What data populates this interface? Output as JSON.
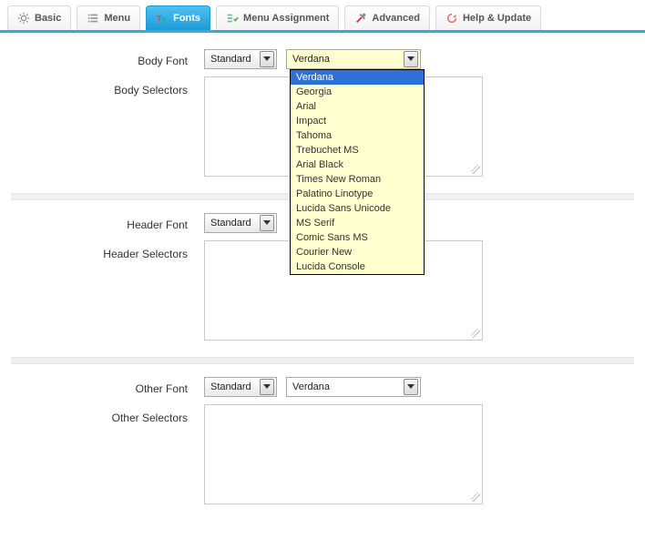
{
  "tabs": {
    "basic": "Basic",
    "menu": "Menu",
    "fonts": "Fonts",
    "menu_assignment": "Menu Assignment",
    "advanced": "Advanced",
    "help_update": "Help & Update"
  },
  "sections": {
    "body": {
      "font_label": "Body Font",
      "selectors_label": "Body Selectors",
      "type_value": "Standard",
      "font_value": "Verdana"
    },
    "header": {
      "font_label": "Header Font",
      "selectors_label": "Header Selectors",
      "type_value": "Standard"
    },
    "other": {
      "font_label": "Other Font",
      "selectors_label": "Other Selectors",
      "type_value": "Standard",
      "font_value": "Verdana"
    }
  },
  "font_options": [
    "Verdana",
    "Georgia",
    "Arial",
    "Impact",
    "Tahoma",
    "Trebuchet MS",
    "Arial Black",
    "Times New Roman",
    "Palatino Linotype",
    "Lucida Sans Unicode",
    "MS Serif",
    "Comic Sans MS",
    "Courier New",
    "Lucida Console"
  ],
  "colors": {
    "accent": "#36a9e1",
    "dropdown_bg": "#ffffcf",
    "highlight": "#2f6fd8"
  }
}
